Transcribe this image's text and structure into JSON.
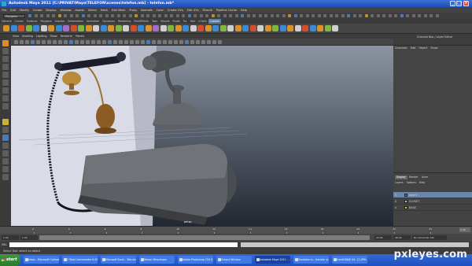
{
  "window": {
    "title": "Autodesk Maya 2011 [C:\\PRIVAT\\Maya\\TELEFON\\scenes\\telefon.mb] - telefon.mb*",
    "controls": [
      "_",
      "□",
      "×"
    ]
  },
  "menubar": {
    "items": [
      "File",
      "Edit",
      "Modify",
      "Create",
      "Display",
      "Window",
      "Assets",
      "Select",
      "Mesh",
      "Edit Mesh",
      "Proxy",
      "Normals",
      "Color",
      "Create UVs",
      "Edit UVs",
      "Muscle",
      "Pipeline Cache",
      "Help"
    ]
  },
  "statusline": {
    "mode": "Polygons"
  },
  "shelf": {
    "tabs": [
      "General",
      "Curves",
      "Surfaces",
      "Polygons",
      "Subdivs",
      "Deformation",
      "Animation",
      "Dynamics",
      "Rendering",
      "PaintEffects",
      "Toon",
      "Muscle",
      "Fluids",
      "Fur",
      "Hair",
      "nCloth",
      "Custom"
    ],
    "active_tab": "Custom",
    "icons": [
      "#d8942a",
      "#3b8ad6",
      "#d44e2c",
      "#7fb742",
      "#3b8ad6",
      "#cfcfcf",
      "#d8942a",
      "#3b8ad6",
      "#a66cc9",
      "#d44e2c",
      "#7fb742",
      "#d8942a",
      "#cfcfcf",
      "#3b8ad6",
      "#d8942a",
      "#7fb742",
      "#cfcfcf",
      "#d44e2c",
      "#3b8ad6",
      "#d8942a",
      "#a66cc9",
      "#cfcfcf",
      "#7fb742",
      "#d8942a",
      "#3b8ad6",
      "#cfcfcf",
      "#d44e2c",
      "#d8942a",
      "#3b8ad6",
      "#7fb742",
      "#cfcfcf",
      "#d8942a",
      "#3b8ad6",
      "#d44e2c",
      "#cfcfcf",
      "#d8942a",
      "#7fb742",
      "#3b8ad6",
      "#d8942a",
      "#cfcfcf",
      "#d44e2c",
      "#3b8ad6",
      "#d8942a",
      "#7fb742",
      "#cfcfcf"
    ]
  },
  "viewport": {
    "menu": [
      "View",
      "Shading",
      "Lighting",
      "Show",
      "Renderer",
      "Panels"
    ],
    "camera_label": "persp"
  },
  "channel_box": {
    "title": "Channel Box / Layer Editor",
    "menu": [
      "Channels",
      "Edit",
      "Object",
      "Show"
    ]
  },
  "layer_editor": {
    "tabs": [
      "Display",
      "Render",
      "Anim"
    ],
    "active_tab": "Display",
    "menu": [
      "Layers",
      "Options",
      "Help"
    ],
    "layers": [
      {
        "visible": "V",
        "color": "#5a62c8",
        "name": "layer3",
        "selected": true
      },
      {
        "visible": "V",
        "color": "#c8c8c8",
        "name": "CLOSET",
        "selected": false
      },
      {
        "visible": "V",
        "color": "#d8d020",
        "name": "BASE",
        "selected": false
      }
    ]
  },
  "time_slider": {
    "ticks": [
      "2",
      "4",
      "6",
      "8",
      "10",
      "12",
      "14",
      "16",
      "18",
      "20",
      "22",
      "24"
    ],
    "current_frame": "1.00"
  },
  "range_slider": {
    "start": "1.00",
    "end": "24.00",
    "playback_start": "1.00",
    "playback_end": "48.00",
    "char_set": "No Character Set"
  },
  "command_line": {
    "label": "MEL"
  },
  "help_line": {
    "text": "Select Tool: select an object"
  },
  "taskbar": {
    "start_label": "start",
    "tasks": [
      {
        "label": "Inbox - Microsoft Outlook",
        "active": false
      },
      {
        "label": "2 Total Commander 6.53",
        "active": false
      },
      {
        "label": "Microsoft Excel - Tele.xls",
        "active": false
      },
      {
        "label": "Yahoo! Messenger",
        "active": false
      },
      {
        "label": "Adobe Photoshop CS4 E...",
        "active": false
      },
      {
        "label": "Output Window",
        "active": false
      },
      {
        "label": "Autodesk Maya 2011 - ...",
        "active": true
      },
      {
        "label": "Translate.ro - transfer si...",
        "active": false
      },
      {
        "label": "CorelDRAW X4 - [C:\\PRI...",
        "active": false
      }
    ]
  },
  "watermark": "pxleyes.com"
}
